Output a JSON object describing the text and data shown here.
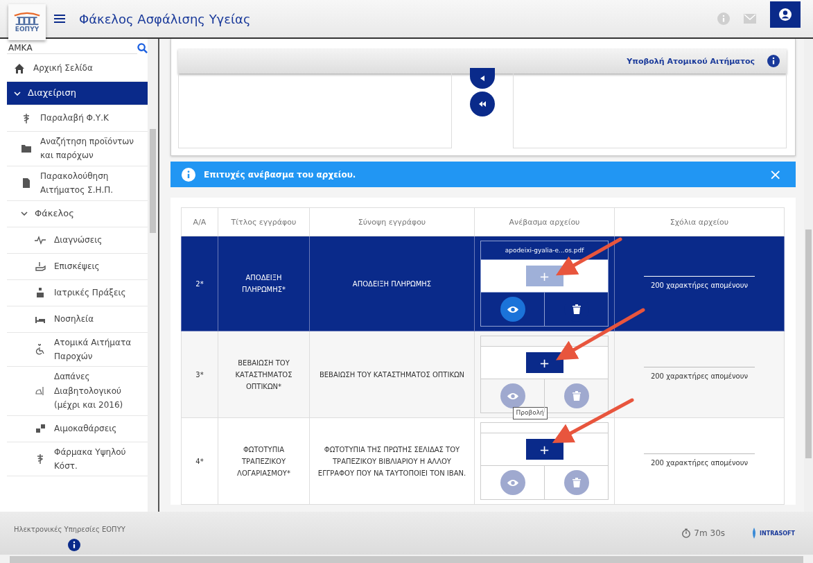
{
  "header": {
    "logo_text": "ΕΟΠΥΥ",
    "title": "Φάκελος Ασφάλισης Υγείας"
  },
  "sidebar": {
    "search": {
      "placeholder": "ΑΜΚΑ"
    },
    "items": [
      {
        "kind": "link",
        "label": "Αρχική Σελίδα",
        "selected": false
      },
      {
        "kind": "section",
        "label": "Διαχείριση",
        "selected": true,
        "expanded": true,
        "children": [
          {
            "kind": "link",
            "label": "Παραλαβή Φ.Υ.Κ",
            "selected": false
          },
          {
            "kind": "link",
            "label": "Αναζήτηση προϊόντων και παρόχων",
            "selected": false
          },
          {
            "kind": "link",
            "label": "Παρακολούθηση Αιτήματος Σ.Η.Π.",
            "selected": false
          },
          {
            "kind": "section",
            "label": "Φάκελος",
            "selected": false,
            "expanded": true,
            "children": [
              {
                "kind": "link",
                "label": "Διαγνώσεις",
                "selected": false
              },
              {
                "kind": "link",
                "label": "Επισκέψεις",
                "selected": false
              },
              {
                "kind": "link",
                "label": "Ιατρικές Πράξεις",
                "selected": false
              },
              {
                "kind": "link",
                "label": "Νοσηλεία",
                "selected": false
              },
              {
                "kind": "link",
                "label": "Ατομικά Αιτήματα Παροχών",
                "selected": false
              },
              {
                "kind": "link",
                "label": "Δαπάνες Διαβητολογικού (μέχρι και 2016)",
                "selected": false
              },
              {
                "kind": "link",
                "label": "Αιμοκαθάρσεις",
                "selected": false
              },
              {
                "kind": "link",
                "label": "Φάρμακα Υψηλού Κόστ.",
                "selected": false
              }
            ]
          }
        ]
      }
    ]
  },
  "request_panel": {
    "title": "Υποβολή Ατομικού Αιτήματος"
  },
  "alert": {
    "message": "Επιτυχές ανέβασμα του αρχείου.",
    "close": "×"
  },
  "table": {
    "columns": [
      "Α/Α",
      "Τίτλος εγγράφου",
      "Σύνοψη εγγράφου",
      "Ανέβασμα αρχείου",
      "Σχόλια αρχείου"
    ],
    "rows": [
      {
        "number": "2*",
        "title": "ΑΠΟΔΕΙΞΗ ΠΛΗΡΩΜΗΣ*",
        "summary": "ΑΠΟΔΕΙΞΗ ΠΛΗΡΩΜΗΣ",
        "file": "apodeixi-gyalia-e...os.pdf",
        "add_button": "+",
        "selected": true,
        "upload_disabled": true,
        "actions_disabled": false,
        "comment_hint": "200 χαρακτήρες απομένουν"
      },
      {
        "number": "3*",
        "title": "ΒΕΒΑΙΩΣΗ ΤΟΥ ΚΑΤΑΣΤΗΜΑΤΟΣ ΟΠΤΙΚΩΝ*",
        "summary": "ΒΕΒΑΙΩΣΗ ΤΟΥ ΚΑΤΑΣΤΗΜΑΤΟΣ ΟΠΤΙΚΩΝ",
        "add_button": "+",
        "selected": false,
        "upload_disabled": false,
        "actions_disabled": true,
        "tooltip": "Προβολή",
        "comment_hint": "200 χαρακτήρες απομένουν"
      },
      {
        "number": "4*",
        "title": "ΦΩΤΟΤΥΠΙΑ ΤΡΑΠΕΖΙΚΟΥ ΛΟΓΑΡΙΑΣΜΟΥ*",
        "summary": "ΦΩΤΟΤΥΠΙΑ ΤΗΣ ΠΡΩΤΗΣ ΣΕΛΙΔΑΣ ΤΟΥ ΤΡΑΠΕΖΙΚΟΥ ΒΙΒΛΙΑΡΙΟΥ Η ΑΛΛΟΥ ΕΓΓΡΑΦΟΥ ΠΟΥ ΝΑ ΤΑΥΤΟΠΟΙΕΙ ΤΟΝ IBAN.",
        "add_button": "+",
        "selected": false,
        "upload_disabled": false,
        "actions_disabled": true,
        "comment_hint": "200 χαρακτήρες απομένουν"
      }
    ]
  },
  "footer": {
    "text": "Ηλεκτρονικές Υπηρεσίες ΕΟΠΥΥ",
    "timer": "7m 30s",
    "brand": "INTRASOFT"
  }
}
